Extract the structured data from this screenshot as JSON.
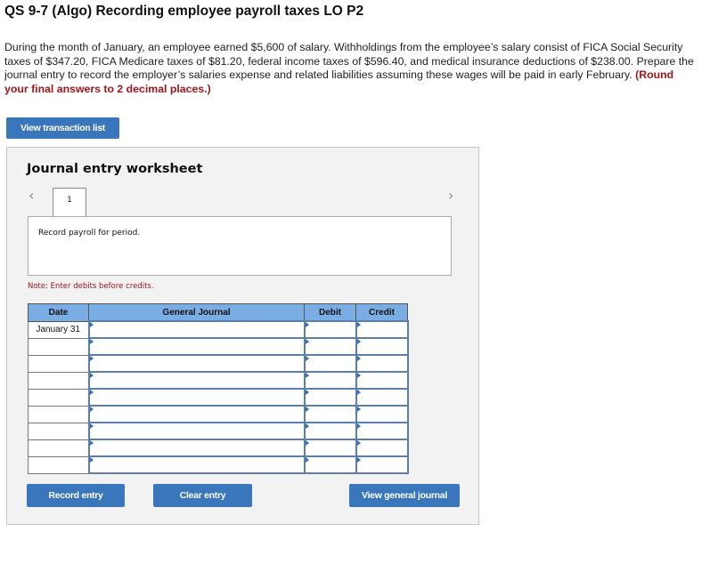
{
  "question": {
    "title": "QS 9-7 (Algo) Recording employee payroll taxes LO P2",
    "body": "During the month of January, an employee earned $5,600 of salary. Withholdings from the employee’s salary consist of FICA Social Security taxes of $347.20, FICA Medicare taxes of $81.20, federal income taxes of $596.40, and medical insurance deductions of $238.00. Prepare the journal entry to record the employer’s salaries expense and related liabilities assuming these wages will be paid in early February.",
    "instruction": "(Round your final answers to 2 decimal places.)"
  },
  "buttons": {
    "view_transaction_list": "View transaction list",
    "record_entry": "Record entry",
    "clear_entry": "Clear entry",
    "view_general_journal": "View general journal"
  },
  "worksheet": {
    "title": "Journal entry worksheet",
    "prev_icon": "‹",
    "next_icon": "›",
    "current_tab": "1",
    "description": "Record payroll for period.",
    "note": "Note: Enter debits before credits."
  },
  "journal": {
    "headers": {
      "date": "Date",
      "general_journal": "General Journal",
      "debit": "Debit",
      "credit": "Credit"
    },
    "rows": [
      {
        "date": "January 31",
        "account": "",
        "debit": "",
        "credit": ""
      },
      {
        "date": "",
        "account": "",
        "debit": "",
        "credit": ""
      },
      {
        "date": "",
        "account": "",
        "debit": "",
        "credit": ""
      },
      {
        "date": "",
        "account": "",
        "debit": "",
        "credit": ""
      },
      {
        "date": "",
        "account": "",
        "debit": "",
        "credit": ""
      },
      {
        "date": "",
        "account": "",
        "debit": "",
        "credit": ""
      },
      {
        "date": "",
        "account": "",
        "debit": "",
        "credit": ""
      },
      {
        "date": "",
        "account": "",
        "debit": "",
        "credit": ""
      },
      {
        "date": "",
        "account": "",
        "debit": "",
        "credit": ""
      }
    ]
  },
  "colors": {
    "button_blue": "#3a76bb",
    "header_blue": "#7aade3",
    "note_red": "#a3151c"
  }
}
